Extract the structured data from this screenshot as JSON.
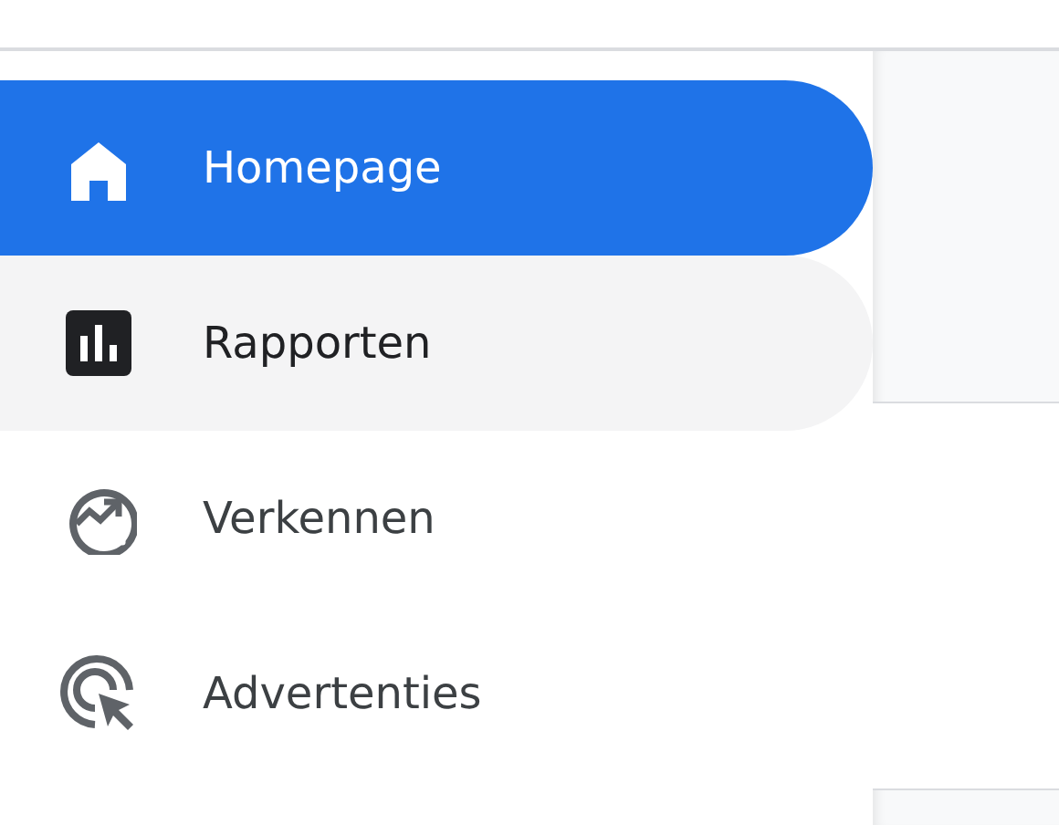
{
  "sidebar": {
    "items": [
      {
        "kind": "home",
        "label": "Homepage",
        "selected": true,
        "hovered": false
      },
      {
        "kind": "reports",
        "label": "Rapporten",
        "selected": false,
        "hovered": true
      },
      {
        "kind": "explore",
        "label": "Verkennen",
        "selected": false,
        "hovered": false
      },
      {
        "kind": "ads",
        "label": "Advertenties",
        "selected": false,
        "hovered": false
      }
    ]
  }
}
